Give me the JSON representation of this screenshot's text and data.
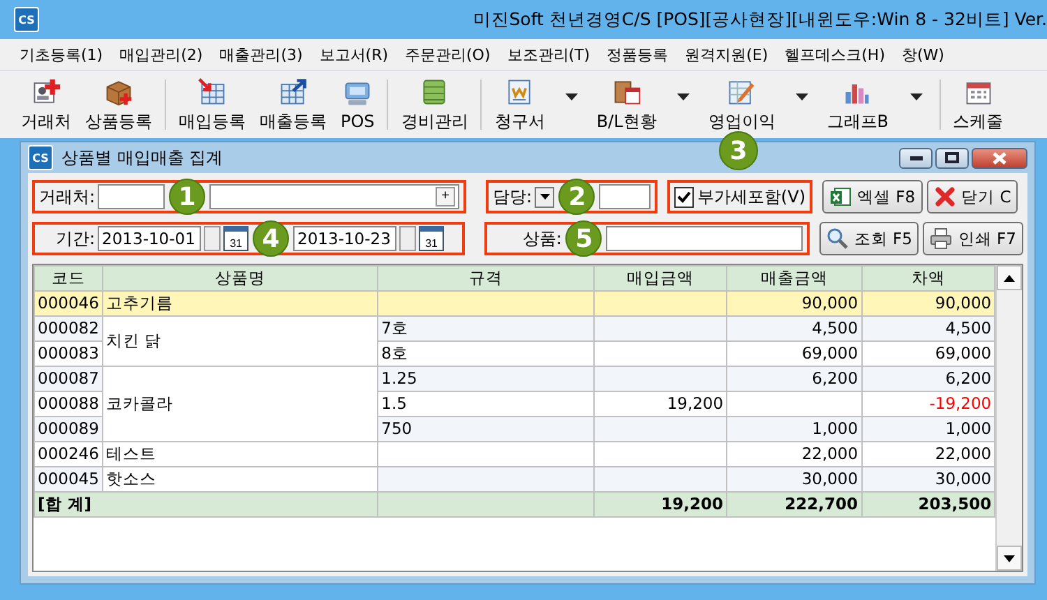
{
  "window": {
    "logo": "CS",
    "title": "미진Soft 천년경영C/S [POS][공사현장][내윈도우:Win 8 - 32비트] Ver."
  },
  "menu": [
    "기초등록(1)",
    "매입관리(2)",
    "매출관리(3)",
    "보고서(R)",
    "주문관리(O)",
    "보조관리(T)",
    "정품등록",
    "원격지원(E)",
    "헬프데스크(H)",
    "창(W)"
  ],
  "toolbar": [
    {
      "label": "거래처",
      "kind": "card",
      "dropdown": false,
      "separator_before": false
    },
    {
      "label": "상품등록",
      "kind": "box",
      "dropdown": false,
      "separator_before": false
    },
    {
      "label": "매입등록",
      "kind": "sheet-in",
      "dropdown": false,
      "separator_before": true
    },
    {
      "label": "매출등록",
      "kind": "sheet-out",
      "dropdown": false,
      "separator_before": false
    },
    {
      "label": "POS",
      "kind": "monitor",
      "dropdown": false,
      "separator_before": false
    },
    {
      "label": "경비관리",
      "kind": "money",
      "dropdown": false,
      "separator_before": true
    },
    {
      "label": "청구서",
      "kind": "invoice",
      "dropdown": true,
      "separator_before": true
    },
    {
      "label": "B/L현황",
      "kind": "ledger",
      "dropdown": true,
      "separator_before": false
    },
    {
      "label": "영업이익",
      "kind": "pencil",
      "dropdown": true,
      "separator_before": false
    },
    {
      "label": "그래프B",
      "kind": "bars",
      "dropdown": true,
      "separator_before": false
    },
    {
      "label": "스케줄",
      "kind": "calendar",
      "dropdown": false,
      "separator_before": true
    }
  ],
  "child_window": {
    "logo": "CS",
    "title": "상품별 매입매출 집계"
  },
  "filters": {
    "customer": {
      "label": "거래처:",
      "button": "+",
      "callout": "1"
    },
    "manager": {
      "label": "담당:",
      "callout": "2"
    },
    "vat": {
      "label": "부가세포함(V)",
      "checked": true,
      "callout": "3"
    },
    "period": {
      "label": "기간:",
      "from": "2013-10-01",
      "to": "2013-10-23",
      "from_calendar_day": "31",
      "to_calendar_day": "31",
      "callout": "4"
    },
    "product": {
      "label": "상품:",
      "callout": "5"
    }
  },
  "buttons": [
    {
      "label": "엑셀 F8",
      "kind": "excel"
    },
    {
      "label": "닫기 C",
      "kind": "close"
    },
    {
      "label": "조회 F5",
      "kind": "search"
    },
    {
      "label": "인쇄 F7",
      "kind": "print"
    }
  ],
  "grid": {
    "columns": [
      "코드",
      "상품명",
      "규격",
      "매입금액",
      "매출금액",
      "차액"
    ],
    "groups": [
      {
        "name": "고추기름",
        "items": [
          {
            "code": "000046",
            "sales": "90,000",
            "diff": "90,000",
            "negative": false,
            "selected": true
          }
        ]
      },
      {
        "name": "치킨 닭",
        "items": [
          {
            "code": "000082",
            "spec": "7호",
            "sales": "4,500",
            "diff": "4,500",
            "negative": false,
            "selected": false
          },
          {
            "code": "000083",
            "spec": "8호",
            "sales": "69,000",
            "diff": "69,000",
            "negative": false,
            "selected": false
          }
        ]
      },
      {
        "name": "코카콜라",
        "items": [
          {
            "code": "000087",
            "spec": "1.25",
            "sales": "6,200",
            "diff": "6,200",
            "negative": false,
            "selected": false
          },
          {
            "code": "000088",
            "spec": "1.5",
            "purchase": "19,200",
            "diff": "-19,200",
            "negative": true,
            "selected": false
          },
          {
            "code": "000089",
            "spec": "750",
            "sales": "1,000",
            "diff": "1,000",
            "negative": false,
            "selected": false
          }
        ]
      },
      {
        "name": "테스트",
        "items": [
          {
            "code": "000246",
            "sales": "22,000",
            "diff": "22,000",
            "negative": false,
            "selected": false
          }
        ]
      },
      {
        "name": "핫소스",
        "items": [
          {
            "code": "000045",
            "sales": "30,000",
            "diff": "30,000",
            "negative": false,
            "selected": false
          }
        ]
      }
    ],
    "total": {
      "label": "[합 계]",
      "purchase": "19,200",
      "sales": "222,700",
      "diff": "203,500"
    }
  }
}
